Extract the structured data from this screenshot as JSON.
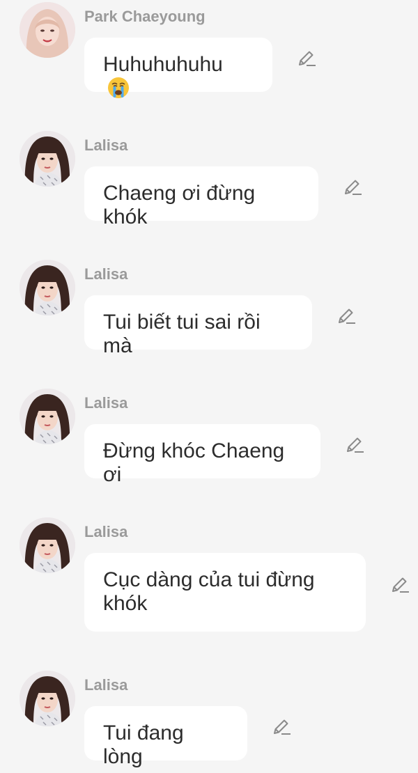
{
  "messages": [
    {
      "sender": "Park Chaeyoung",
      "text": "Huhuhuhuhu",
      "emoji": "crying-face-emoji",
      "avatar": "avatar-park-chaeyoung",
      "action_icon": "edit-pencil-icon"
    },
    {
      "sender": "Lalisa",
      "text": "Chaeng ơi đừng khók",
      "avatar": "avatar-lalisa",
      "action_icon": "edit-pencil-icon"
    },
    {
      "sender": "Lalisa",
      "text": "Tui biết tui sai rồi mà",
      "avatar": "avatar-lalisa",
      "action_icon": "edit-pencil-icon"
    },
    {
      "sender": "Lalisa",
      "text": "Đừng khóc Chaeng ơi",
      "avatar": "avatar-lalisa",
      "action_icon": "edit-pencil-icon"
    },
    {
      "sender": "Lalisa",
      "text": "Cục dàng của tui đừng khók",
      "avatar": "avatar-lalisa",
      "action_icon": "edit-pencil-icon"
    },
    {
      "sender": "Lalisa",
      "text": "Tui đang lòng",
      "avatar": "avatar-lalisa",
      "action_icon": "edit-pencil-icon"
    }
  ],
  "colors": {
    "background": "#f5f5f5",
    "bubble": "#ffffff",
    "sender_name": "#9a9a9a",
    "message_text": "#2c2c2c",
    "icon": "#8a8a8a"
  }
}
